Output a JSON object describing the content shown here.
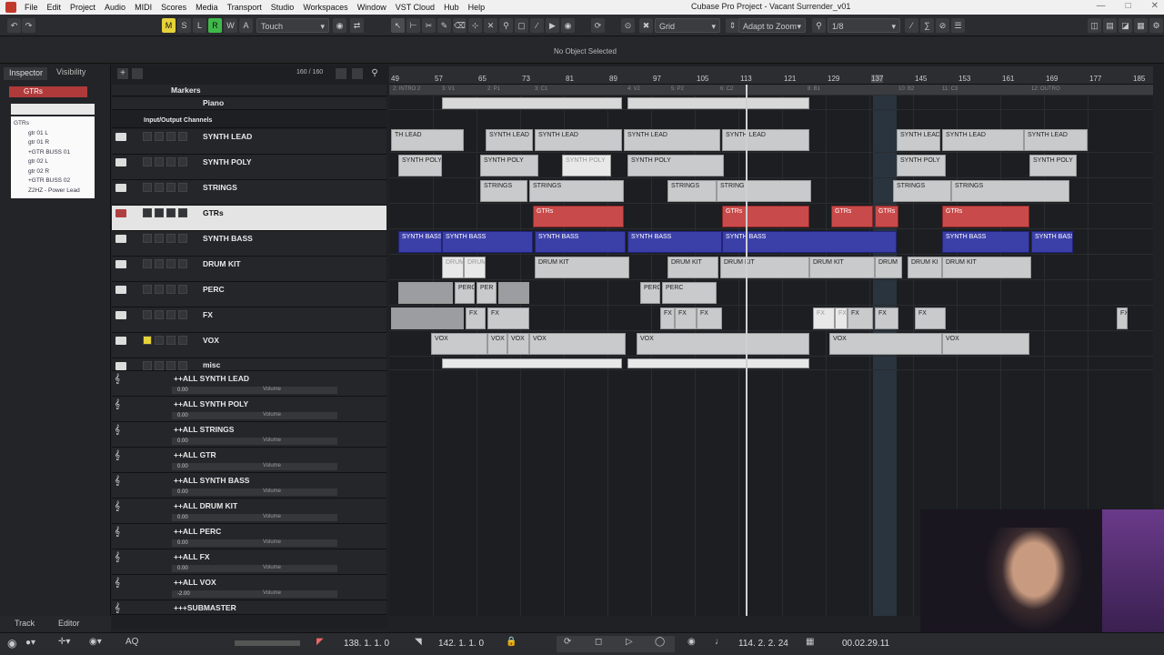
{
  "window": {
    "title": "Cubase Pro Project - Vacant Surrender_v01"
  },
  "menu": [
    "File",
    "Edit",
    "Project",
    "Audio",
    "MIDI",
    "Scores",
    "Media",
    "Transport",
    "Studio",
    "Workspaces",
    "Window",
    "VST Cloud",
    "Hub",
    "Help"
  ],
  "toolbar": {
    "mode_buttons": [
      "M",
      "S",
      "L",
      "R",
      "W",
      "A"
    ],
    "automation_mode": "Touch",
    "snap_type": "Grid",
    "grid_mode": "Adapt to Zoom",
    "quantize": "1/8"
  },
  "infoline": {
    "text": "No Object Selected"
  },
  "inspector": {
    "tabs": [
      "Inspector",
      "Visibility"
    ],
    "track": "GTRs",
    "tracklist": [
      "GTRs",
      "gtr 01 L",
      "gtr 01 R",
      "+GTR BUSS 01",
      "gtr 02 L",
      "gtr 02 R",
      "+GTR BUSS 02",
      "Z2HZ - Power Lead"
    ]
  },
  "trackheader": {
    "counter": "160 / 160"
  },
  "ruler": {
    "labels": [
      "49",
      "57",
      "65",
      "73",
      "81",
      "89",
      "97",
      "105",
      "113",
      "121",
      "129",
      "137",
      "145",
      "153",
      "161",
      "169",
      "177",
      "185"
    ]
  },
  "marker_track": {
    "name": "Markers",
    "labels": [
      "2: INTRO 2",
      "3: V1",
      "2: P1",
      "3: C1",
      "4: V2",
      "5: P2",
      "6: C2",
      "8: B1",
      "10: B2",
      "11: C3",
      "12: OUTRO"
    ]
  },
  "tracks": [
    {
      "name": "Piano",
      "type": "instrument"
    },
    {
      "name": "Input/Output Channels",
      "type": "folder"
    },
    {
      "name": "SYNTH LEAD",
      "type": "folder"
    },
    {
      "name": "SYNTH POLY",
      "type": "folder"
    },
    {
      "name": "STRINGS",
      "type": "folder"
    },
    {
      "name": "GTRs",
      "type": "folder",
      "selected": true
    },
    {
      "name": "SYNTH BASS",
      "type": "folder"
    },
    {
      "name": "DRUM KIT",
      "type": "folder"
    },
    {
      "name": "PERC",
      "type": "folder"
    },
    {
      "name": "FX",
      "type": "folder"
    },
    {
      "name": "VOX",
      "type": "folder"
    },
    {
      "name": "misc",
      "type": "folder"
    }
  ],
  "fx_tracks": [
    {
      "name": "++ALL SYNTH LEAD",
      "vol": "0.00",
      "param": "Volume"
    },
    {
      "name": "++ALL SYNTH POLY",
      "vol": "0.00",
      "param": "Volume"
    },
    {
      "name": "++ALL STRINGS",
      "vol": "0.00",
      "param": "Volume"
    },
    {
      "name": "++ALL GTR",
      "vol": "0.00",
      "param": "Volume"
    },
    {
      "name": "++ALL SYNTH BASS",
      "vol": "0.00",
      "param": "Volume"
    },
    {
      "name": "++ALL DRUM KIT",
      "vol": "0.00",
      "param": "Volume"
    },
    {
      "name": "++ALL PERC",
      "vol": "0.00",
      "param": "Volume"
    },
    {
      "name": "++ALL FX",
      "vol": "0.00",
      "param": "Volume"
    },
    {
      "name": "++ALL VOX",
      "vol": "-2.00",
      "param": "Volume"
    },
    {
      "name": "+++SUBMASTER",
      "vol": "",
      "param": ""
    }
  ],
  "events": {
    "synth_lead": [
      "TH LEAD",
      "SYNTH LEAD",
      "SYNTH LEAD",
      "SYNTH LEAD",
      "SYNTH LEAD",
      "SYNTH LEAD",
      "SYNTH LEAD",
      "SYNTH LEAD"
    ],
    "synth_poly": [
      "SYNTH POLY",
      "SYNTH POLY",
      "SYNTH POLY",
      "SYNTH POLY",
      "SYNTH POLY",
      "SYNTH POLY"
    ],
    "strings": [
      "STRINGS",
      "STRINGS",
      "STRINGS",
      "STRING",
      "STRINGS",
      "STRINGS"
    ],
    "gtrs": [
      "GTRs",
      "GTRs",
      "GTRs",
      "GTRs",
      "GTRs"
    ],
    "synth_bass": [
      "SYNTH BASS",
      "SYNTH BASS",
      "SYNTH BASS",
      "SYNTH BASS",
      "SYNTH BASS",
      "SYNTH BASS",
      "SYNTH BASS"
    ],
    "drum_kit": [
      "DRUM",
      "DRUM",
      "DRUM KIT",
      "DRUM KIT",
      "DRUM KIT",
      "DRUM KIT",
      "DRUM",
      "DRUM KI",
      "DRUM KIT"
    ],
    "perc": [
      "PERC",
      "PER",
      "PERC",
      "PERC"
    ],
    "fx": [
      "FX",
      "FX",
      "FX",
      "FX",
      "FX",
      "FX",
      "FX",
      "FX",
      "FX",
      "FX",
      "FX"
    ],
    "vox": [
      "VOX",
      "VOX",
      "VOX",
      "VOX",
      "VOX",
      "VOX",
      "VOX"
    ]
  },
  "bottom_tabs": [
    "Track",
    "Editor"
  ],
  "transport": {
    "left_locator": "138.  1.  1.    0",
    "right_locator": "142.  1.  1.    0",
    "position_bars": "114.  2.  2.  24",
    "position_time": "00.02.29.11"
  }
}
